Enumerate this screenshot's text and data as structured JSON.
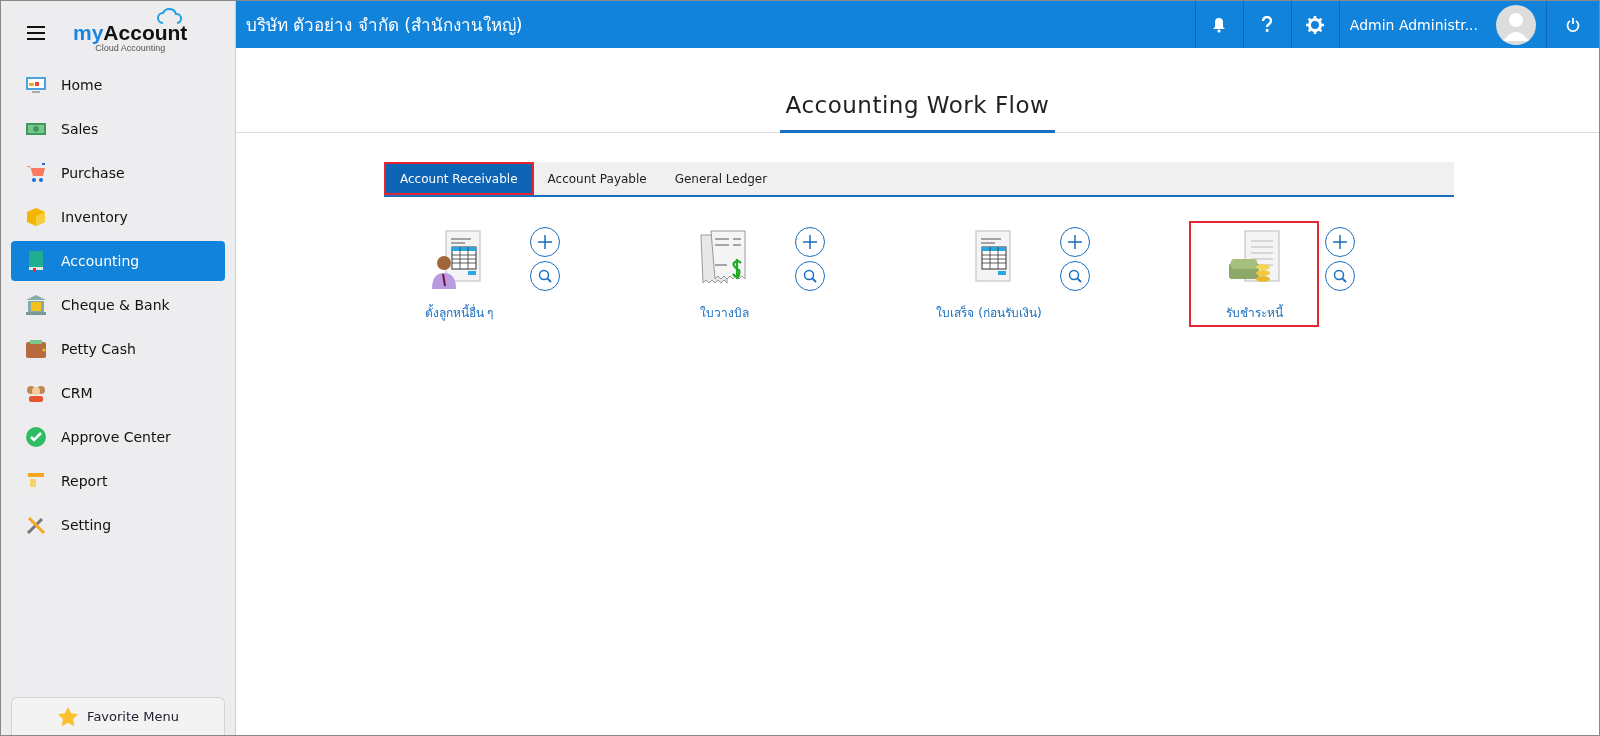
{
  "logo": {
    "brand_prefix": "my",
    "brand_main": "Account",
    "tagline": "Cloud Accounting"
  },
  "sidebar": {
    "items": [
      {
        "label": "Home",
        "selected": false
      },
      {
        "label": "Sales",
        "selected": false
      },
      {
        "label": "Purchase",
        "selected": false
      },
      {
        "label": "Inventory",
        "selected": false
      },
      {
        "label": "Accounting",
        "selected": true
      },
      {
        "label": "Cheque & Bank",
        "selected": false
      },
      {
        "label": "Petty Cash",
        "selected": false
      },
      {
        "label": "CRM",
        "selected": false
      },
      {
        "label": "Approve Center",
        "selected": false
      },
      {
        "label": "Report",
        "selected": false
      },
      {
        "label": "Setting",
        "selected": false
      }
    ],
    "favorite": "Favorite Menu"
  },
  "header": {
    "company": "บริษัท ตัวอย่าง จำกัด (สำนักงานใหญ่)",
    "user": "Admin Administr..."
  },
  "page": {
    "title": "Accounting Work Flow"
  },
  "tabs": [
    {
      "label": "Account Receivable",
      "selected": true,
      "highlighted": true
    },
    {
      "label": "Account Payable",
      "selected": false,
      "highlighted": false
    },
    {
      "label": "General Ledger",
      "selected": false,
      "highlighted": false
    }
  ],
  "workflow": [
    {
      "label": "ตั้งลูกหนี้อื่น ๆ",
      "highlighted": false
    },
    {
      "label": "ใบวางบิล",
      "highlighted": false
    },
    {
      "label": "ใบเสร็จ (ก่อนรับเงิน)",
      "highlighted": false
    },
    {
      "label": "รับชำระหนี้",
      "highlighted": true
    }
  ]
}
